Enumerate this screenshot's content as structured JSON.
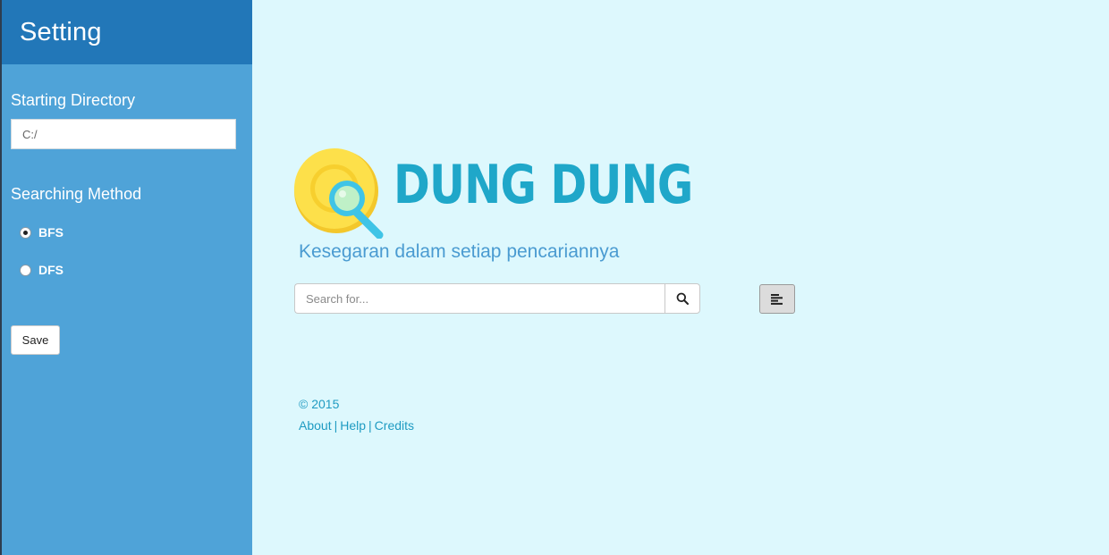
{
  "sidebar": {
    "title": "Setting",
    "starting_directory_label": "Starting Directory",
    "starting_directory_value": "C:/",
    "searching_method_label": "Searching Method",
    "methods": [
      {
        "label": "BFS",
        "checked": true
      },
      {
        "label": "DFS",
        "checked": false
      }
    ],
    "save_label": "Save"
  },
  "main": {
    "logo_text": "DUNG DUNG",
    "tagline": "Kesegaran dalam setiap pencariannya",
    "search": {
      "placeholder": "Search for...",
      "button_icon": "search-icon"
    },
    "toggle_icon": "align-left-icon"
  },
  "footer": {
    "copyright": "© 2015",
    "links": [
      "About",
      "Help",
      "Credits"
    ],
    "separator": "|"
  },
  "colors": {
    "sidebar_bg": "#4fa3d8",
    "sidebar_header_bg": "#2277b8",
    "main_bg": "#ddf8fd",
    "logo_text": "#1fa7c9",
    "tagline": "#4a9bd1",
    "link": "#1f9bc2"
  }
}
